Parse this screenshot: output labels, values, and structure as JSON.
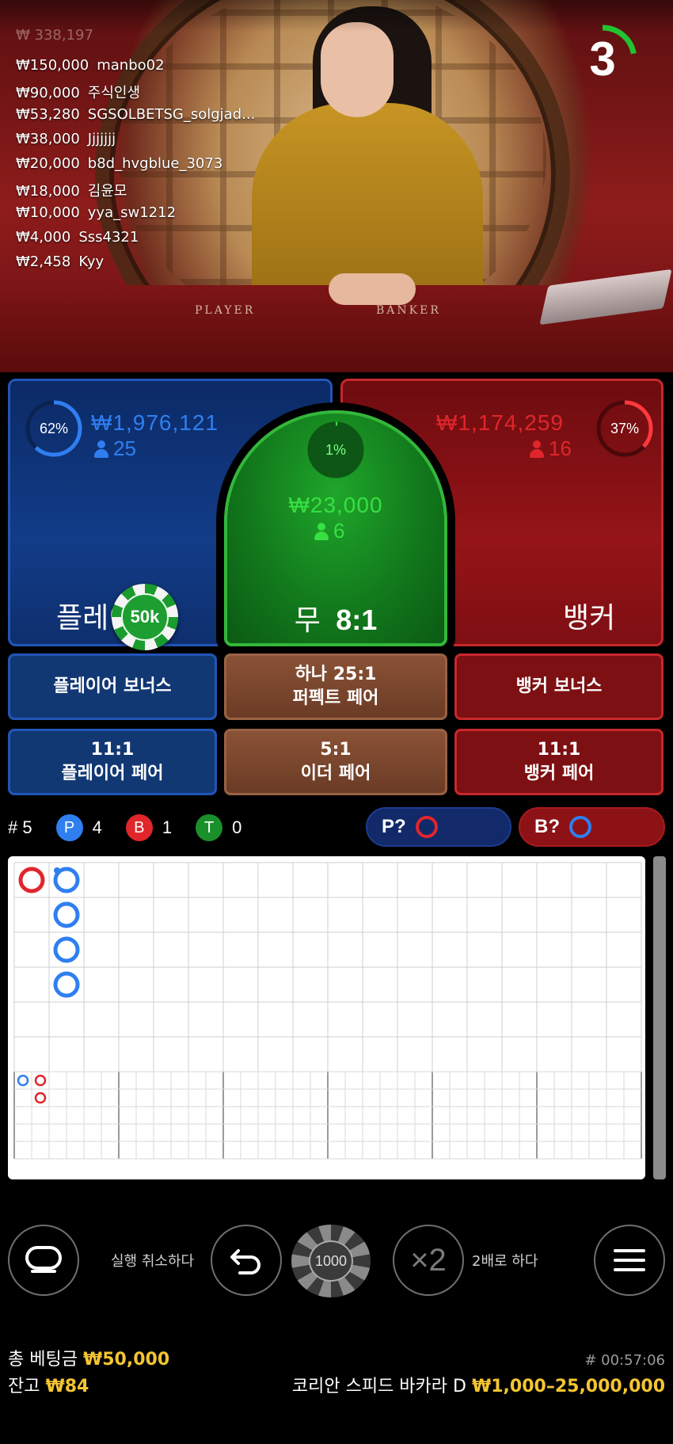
{
  "video": {
    "top_partial": "₩ 338,197",
    "winners": [
      {
        "amount": "₩150,000",
        "name": "manbo02"
      },
      {
        "amount": "₩90,000",
        "name": "주식인생"
      },
      {
        "amount": "₩53,280",
        "name": "SGSOLBETSG_solgjad..."
      },
      {
        "amount": "₩38,000",
        "name": "Jjjjjjj"
      },
      {
        "amount": "₩20,000",
        "name": "b8d_hvgblue_3073"
      },
      {
        "amount": "₩18,000",
        "name": "김윤모"
      },
      {
        "amount": "₩10,000",
        "name": "yya_sw1212"
      },
      {
        "amount": "₩4,000",
        "name": "Sss4321"
      },
      {
        "amount": "₩2,458",
        "name": "Kyy"
      }
    ],
    "table_player_label": "PLAYER",
    "table_banker_label": "BANKER",
    "countdown": "3",
    "countdown_fraction": 0.22
  },
  "player": {
    "percent_label": "62%",
    "percent": 62,
    "stake": "₩1,976,121",
    "bettors": "25",
    "label": "플레이어",
    "chip": "50k"
  },
  "tie": {
    "percent_label": "1%",
    "percent": 1,
    "stake": "₩23,000",
    "bettors": "6",
    "label": "무",
    "payout": "8:1"
  },
  "banker": {
    "percent_label": "37%",
    "percent": 37,
    "stake": "₩1,174,259",
    "bettors": "16",
    "label": "뱅커"
  },
  "side_bets": {
    "player_bonus": "플레이어 보너스",
    "perfect_pair_line1": "하나 25:1",
    "perfect_pair_line2": "퍼펙트 페어",
    "banker_bonus": "뱅커 보너스",
    "player_pair_line1": "11:1",
    "player_pair_line2": "플레이어 페어",
    "either_pair_line1": "5:1",
    "either_pair_line2": "이더 페어",
    "banker_pair_line1": "11:1",
    "banker_pair_line2": "뱅커 페어"
  },
  "stats": {
    "round": "# 5",
    "p_letter": "P",
    "p_count": "4",
    "b_letter": "B",
    "b_count": "1",
    "t_letter": "T",
    "t_count": "0",
    "predict_player": "P?",
    "predict_banker": "B?"
  },
  "road": {
    "big_road": [
      {
        "col": 0,
        "row": 0,
        "result": "B"
      },
      {
        "col": 1,
        "row": 0,
        "result": "P",
        "pair_dot": true
      },
      {
        "col": 1,
        "row": 1,
        "result": "P"
      },
      {
        "col": 1,
        "row": 2,
        "result": "P"
      },
      {
        "col": 1,
        "row": 3,
        "result": "P"
      }
    ]
  },
  "controls": {
    "undo_label": "실행 취소하다",
    "chip_value": "1000",
    "double_symbol": "×2",
    "double_label": "2배로 하다"
  },
  "footer": {
    "total_bet_label": "총 베팅금",
    "total_bet_value": "₩50,000",
    "game_id": "# 00:57:06",
    "balance_label": "잔고",
    "balance_value": "₩84",
    "table_name": "코리안 스피드 바카라 D",
    "limits": "₩1,000–25,000,000"
  },
  "colors": {
    "player": "#2f7ff0",
    "banker": "#e0262b",
    "tie": "#21c331",
    "gold": "#f4c532"
  }
}
